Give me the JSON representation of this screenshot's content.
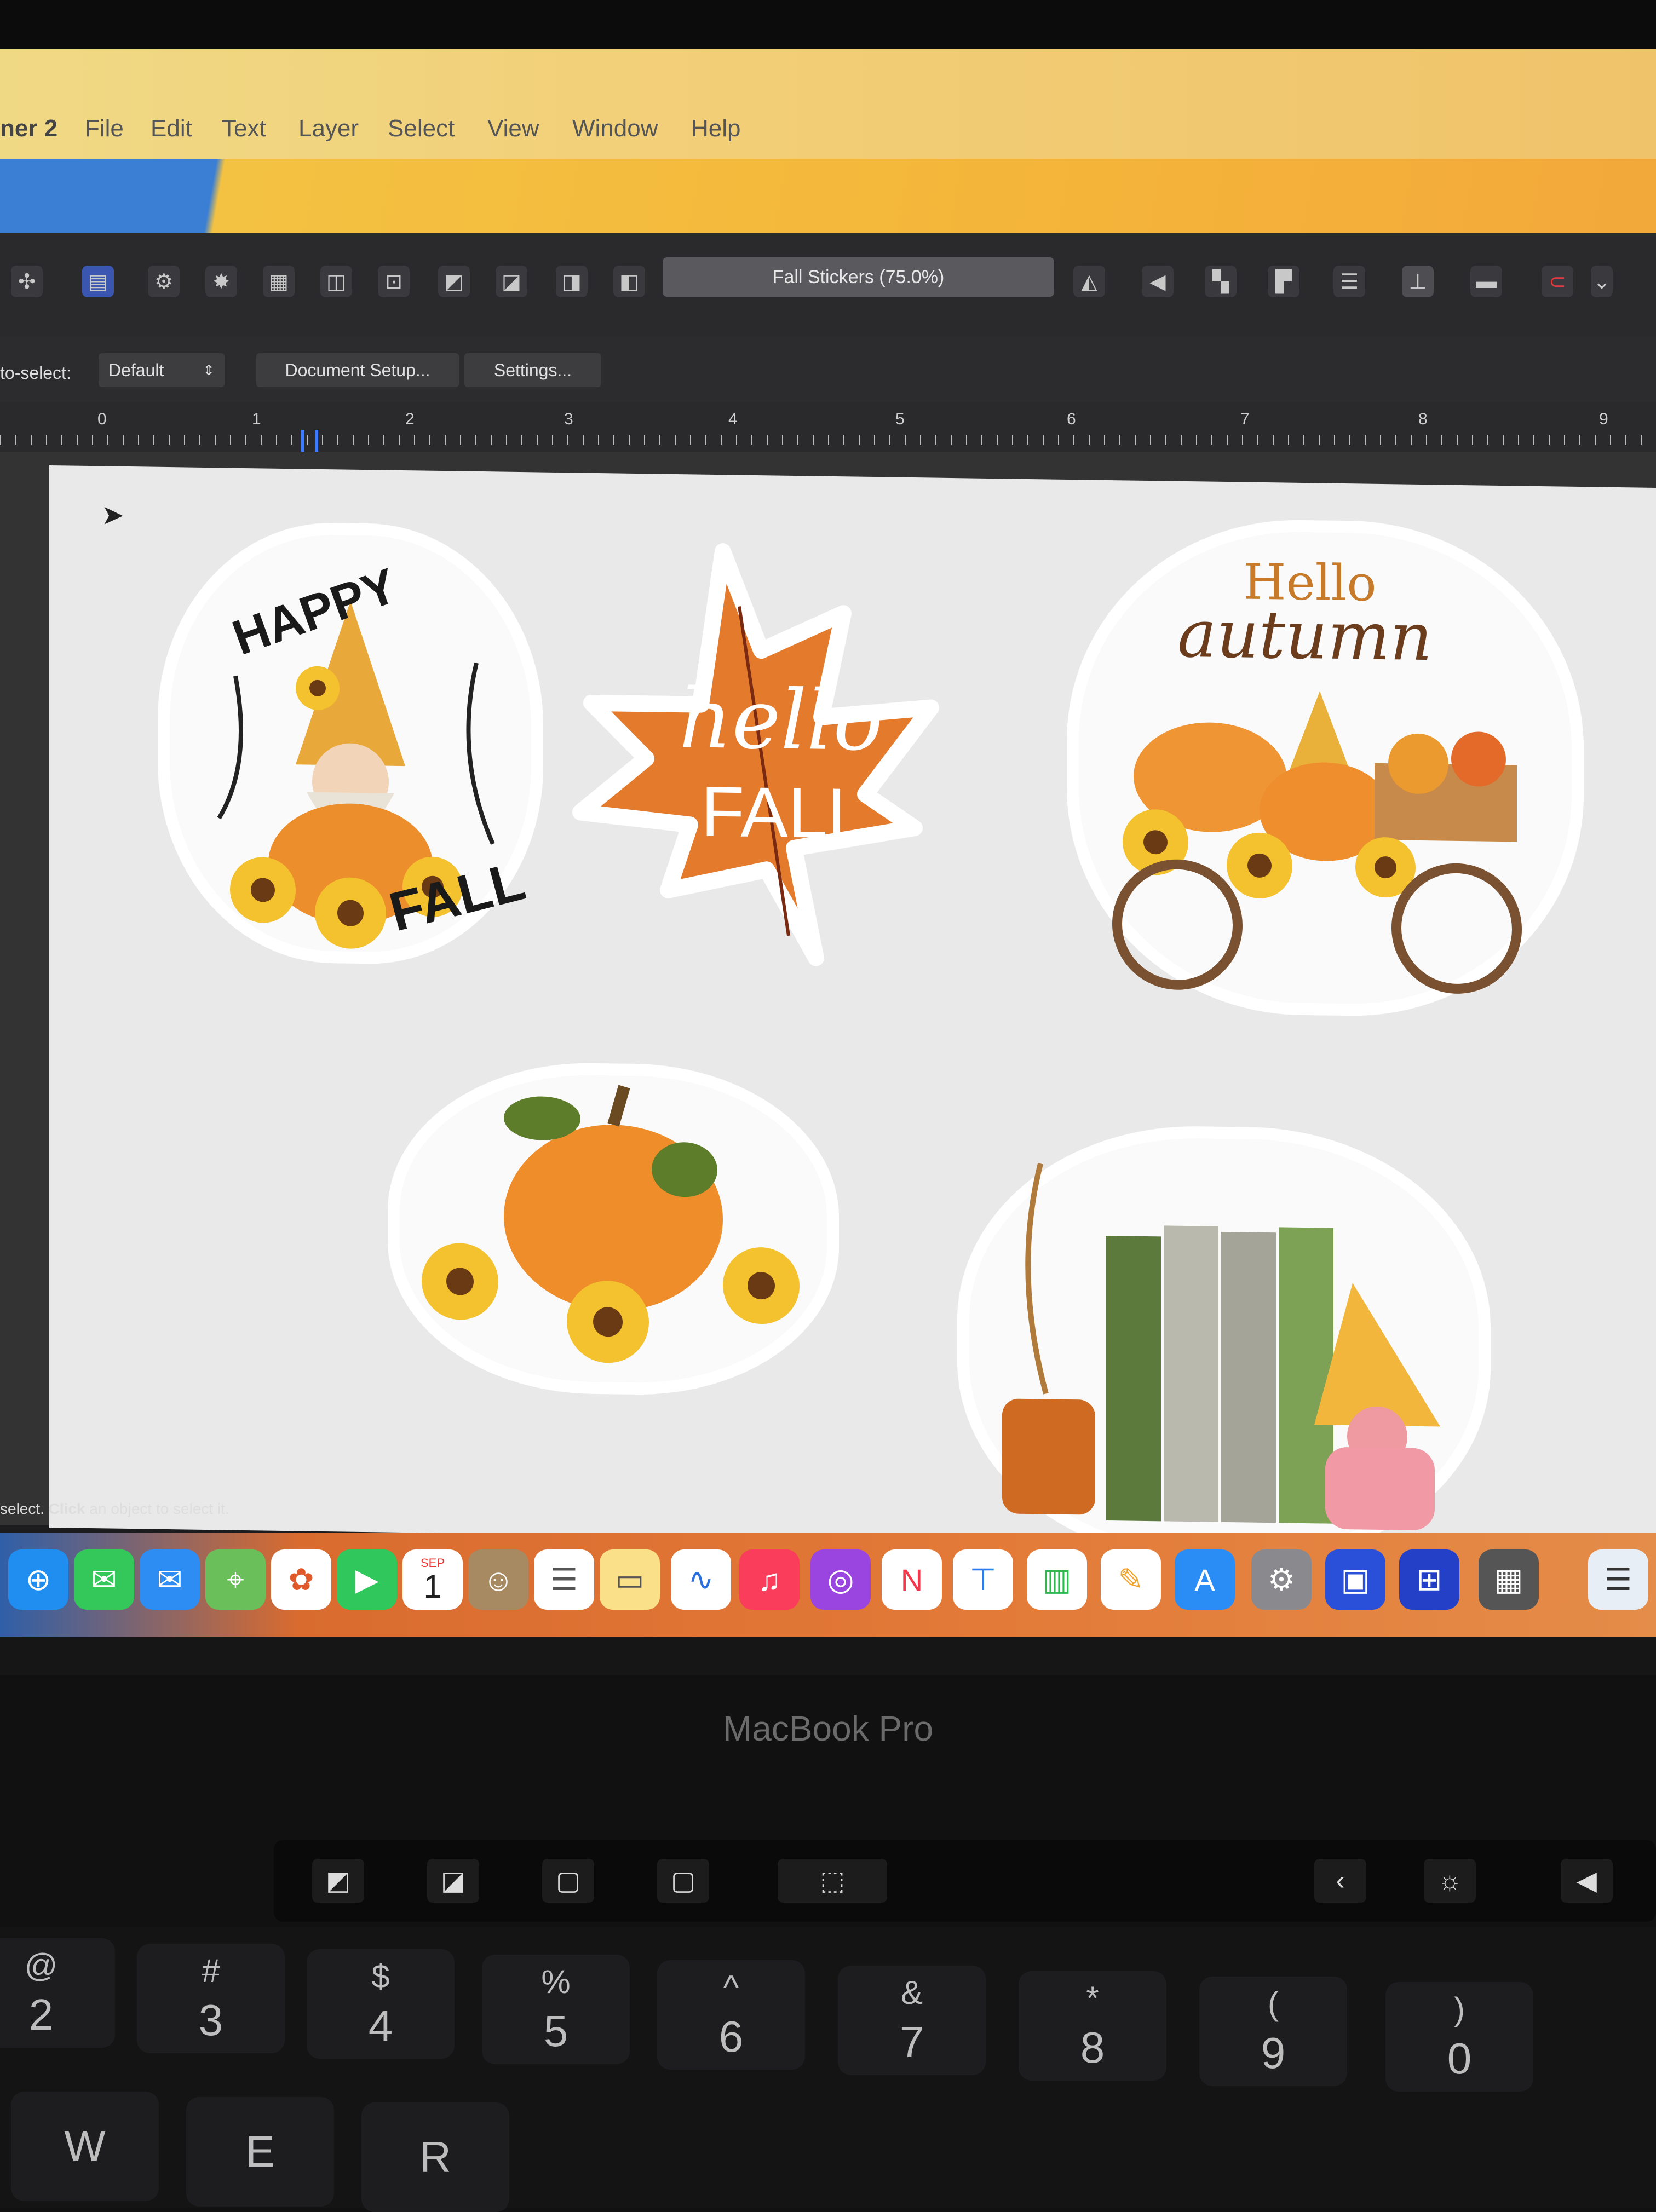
{
  "app": {
    "app_name_fragment": "ner 2",
    "menu": [
      "File",
      "Edit",
      "Text",
      "Layer",
      "Select",
      "View",
      "Window",
      "Help"
    ]
  },
  "toolbar": {
    "document_title": "Fall Stickers (75.0%)",
    "icons": [
      "persona-icon",
      "export-icon",
      "settings-icon",
      "snapping-icon",
      "grid-icon",
      "select-tool-icon",
      "transform-icon",
      "arrange-icon",
      "flip-icon",
      "align-icon",
      "magnet-icon"
    ]
  },
  "context": {
    "auto_select_label": "to-select:",
    "auto_select_value": "Default",
    "document_setup_label": "Document Setup...",
    "settings_label": "Settings..."
  },
  "ruler": {
    "ticks": [
      "0",
      "1",
      "2",
      "3",
      "4",
      "5",
      "6",
      "7",
      "8",
      "9"
    ]
  },
  "canvas": {
    "stickers": [
      {
        "text": "HAPPY FALL",
        "top_text": "HAPPY",
        "bottom_text": "FALL",
        "color": "#f3a534"
      },
      {
        "text": "hello FALL",
        "script": "hello",
        "block": "FALL",
        "color": "#e2762c"
      },
      {
        "text": "Hello autumn",
        "line1": "Hello",
        "line2": "autumn",
        "color": "#e79a3a"
      },
      {
        "text": "",
        "color": "#f08a2a"
      },
      {
        "text": "",
        "color": "#6d8f4a"
      }
    ]
  },
  "status": {
    "prefix": "select. ",
    "bold": "Click",
    "suffix": " an object to select it."
  },
  "dock": {
    "calendar_month": "SEP",
    "calendar_day": "1",
    "apps": [
      "Safari",
      "Messages",
      "Mail",
      "Maps",
      "Photos",
      "FaceTime",
      "Calendar",
      "Contacts",
      "Reminders",
      "Notes",
      "Freeform",
      "Music",
      "Podcasts",
      "News",
      "Keynote",
      "Numbers",
      "Pages",
      "App Store",
      "System Settings",
      "Designer",
      "Affinity",
      "Calculator",
      "Preview"
    ]
  },
  "laptop": {
    "brand": "MacBook Pro",
    "keys": [
      {
        "top": "@",
        "main": "2"
      },
      {
        "top": "#",
        "main": "3"
      },
      {
        "top": "$",
        "main": "4"
      },
      {
        "top": "%",
        "main": "5"
      },
      {
        "top": "^",
        "main": "6"
      },
      {
        "top": "&",
        "main": "7"
      },
      {
        "top": "*",
        "main": "8"
      },
      {
        "top": "(",
        "main": "9"
      },
      {
        "top": ")",
        "main": "0"
      }
    ],
    "bottom_keys": [
      "W",
      "E",
      "R"
    ]
  }
}
